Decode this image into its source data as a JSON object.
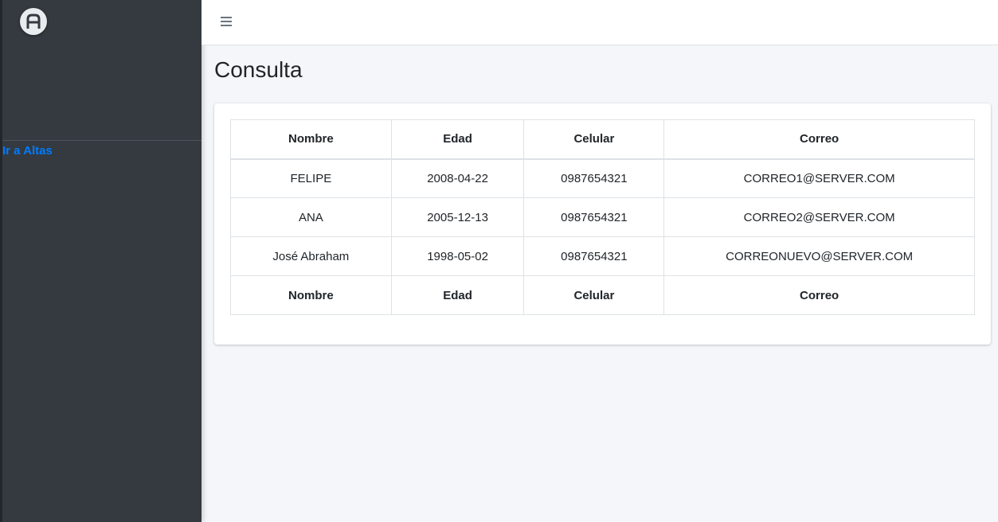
{
  "sidebar": {
    "logo_icon": "brand-logo-icon",
    "nav_link": "Ir a Altas"
  },
  "topbar": {
    "menu_icon": "hamburger-menu-icon"
  },
  "page": {
    "title": "Consulta"
  },
  "table": {
    "headers": [
      "Nombre",
      "Edad",
      "Celular",
      "Correo"
    ],
    "rows": [
      [
        "FELIPE",
        "2008-04-22",
        "0987654321",
        "CORREO1@SERVER.COM"
      ],
      [
        "ANA",
        "2005-12-13",
        "0987654321",
        "CORREO2@SERVER.COM"
      ],
      [
        "José Abraham",
        "1998-05-02",
        "0987654321",
        "CORREONUEVO@SERVER.COM"
      ]
    ],
    "footers": [
      "Nombre",
      "Edad",
      "Celular",
      "Correo"
    ]
  },
  "colors": {
    "sidebar_bg": "#343a40",
    "link": "#007bff",
    "content_bg": "#f4f6f9"
  }
}
